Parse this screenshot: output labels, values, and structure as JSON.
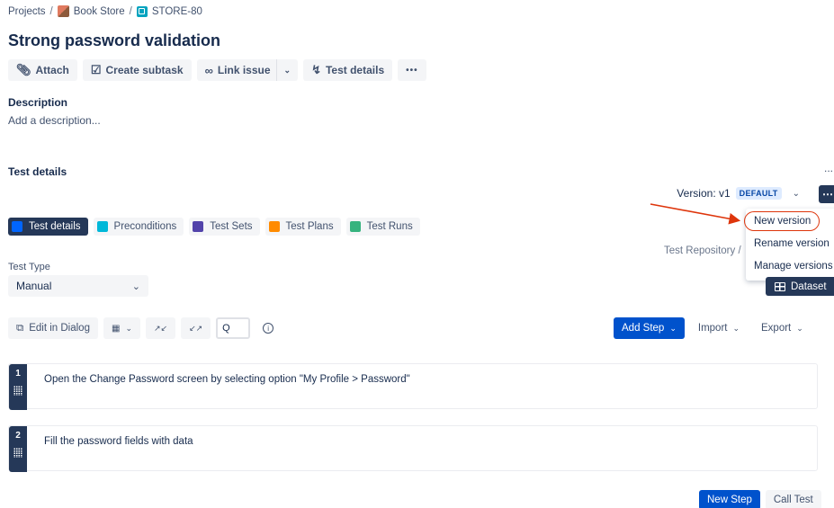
{
  "breadcrumb": {
    "projects": "Projects",
    "sep": "/",
    "project": "Book Store",
    "issue_key": "STORE-80"
  },
  "title": "Strong password validation",
  "toolbar": {
    "attach": "Attach",
    "create_subtask": "Create subtask",
    "link_issue": "Link issue",
    "test_details": "Test details",
    "more": "•••"
  },
  "description": {
    "label": "Description",
    "placeholder": "Add a description..."
  },
  "test_details": {
    "label": "Test details",
    "more": "...",
    "version_label": "Version: v1",
    "version_badge": "DEFAULT"
  },
  "version_menu": {
    "items": [
      "New version",
      "Rename version",
      "Manage versions"
    ]
  },
  "tabs": [
    {
      "label": "Test details",
      "color": "#0065ff"
    },
    {
      "label": "Preconditions",
      "color": "#00b8d9"
    },
    {
      "label": "Test Sets",
      "color": "#5243aa"
    },
    {
      "label": "Test Plans",
      "color": "#ff8b00"
    },
    {
      "label": "Test Runs",
      "color": "#36b37e"
    }
  ],
  "repo_crumb": "Test Repository  /",
  "test_type": {
    "label": "Test Type",
    "value": "Manual"
  },
  "dataset_label": "Dataset",
  "steps_toolbar": {
    "edit_in_dialog": "Edit in Dialog",
    "search_glyph": "Q",
    "add_step": "Add Step",
    "import": "Import",
    "export": "Export"
  },
  "steps": [
    {
      "number": "1",
      "action": "Open the Change Password screen by selecting option \"My Profile > Password\""
    },
    {
      "number": "2",
      "action": "Fill the password fields with data"
    }
  ],
  "bottom": {
    "new_step": "New Step",
    "call_test": "Call Test"
  },
  "colors": {
    "accent": "#0052cc",
    "dark": "#253858",
    "highlight": "#de350b"
  }
}
